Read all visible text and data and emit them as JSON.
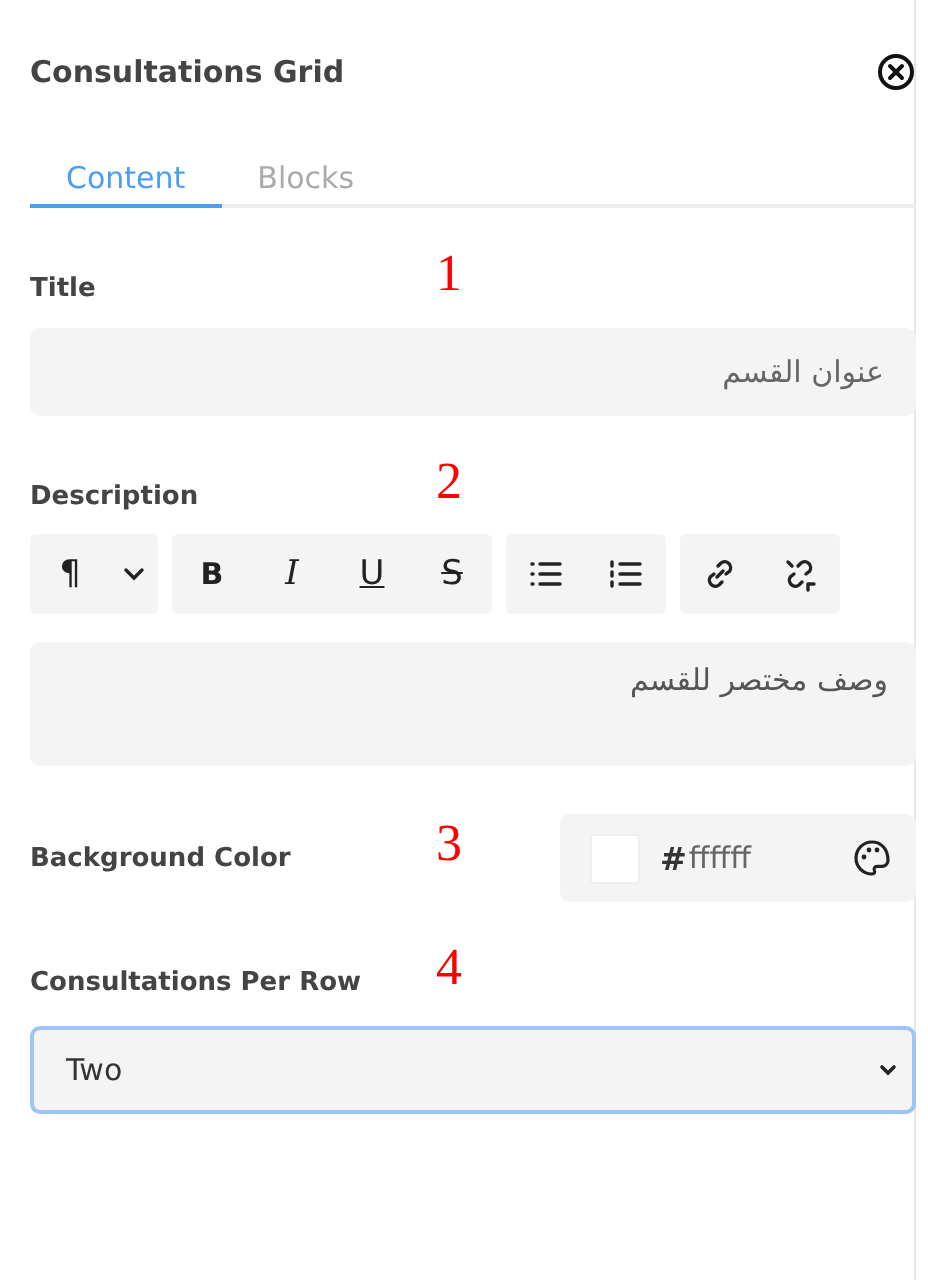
{
  "panel": {
    "title": "Consultations Grid"
  },
  "tabs": [
    {
      "label": "Content",
      "selected": true
    },
    {
      "label": "Blocks",
      "selected": false
    }
  ],
  "fields": [
    {
      "kind": "text",
      "label": "Title",
      "annotation": "1",
      "value": "عنوان القسم"
    },
    {
      "kind": "richtext",
      "label": "Description",
      "annotation": "2",
      "value": "وصف مختصر للقسم",
      "toolbar": {
        "paragraph": "¶",
        "formats": [
          "B",
          "I",
          "U",
          "S"
        ]
      }
    },
    {
      "kind": "color",
      "label": "Background Color",
      "annotation": "3",
      "hash": "#",
      "value": "ffffff",
      "color": "#ffffff"
    },
    {
      "kind": "select",
      "label": "Consultations Per Row",
      "annotation": "4",
      "value": "Two",
      "focused": true
    }
  ]
}
